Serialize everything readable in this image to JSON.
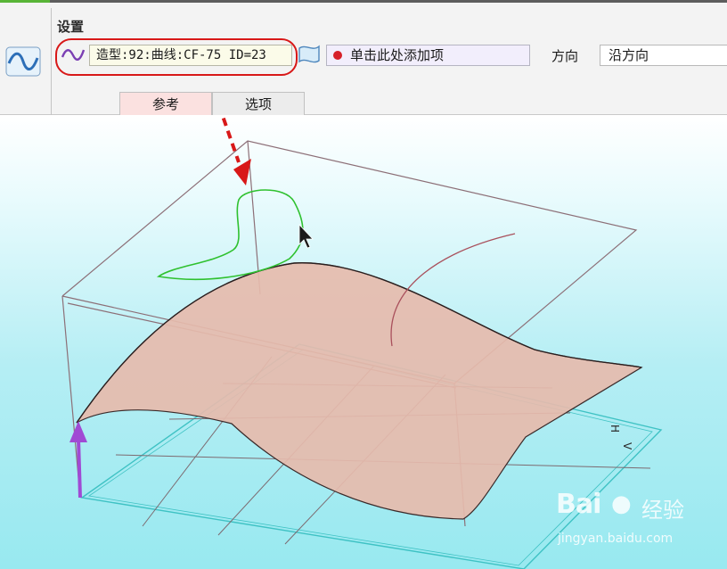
{
  "ribbon": {
    "section_title": "设置",
    "reference_field_value": "造型:92:曲线:CF-75 ID=23",
    "add_item_placeholder": "单击此处添加项",
    "direction_label": "方向",
    "direction_value": "沿方向"
  },
  "tabs": [
    {
      "label": "参考",
      "active": true
    },
    {
      "label": "选项",
      "active": false
    }
  ],
  "viewport": {
    "axis_glyphs": "H",
    "axis_glyphs_2": "V"
  },
  "watermark": {
    "logo": "Bai",
    "logo_cn": "经验",
    "url": "jingyan.baidu.com"
  },
  "colors": {
    "highlight_ring": "#d81818",
    "annotation_arrow": "#d81818",
    "surface_fill": "#e3b9ab",
    "selected_curve": "#2fc12f",
    "plane_edge": "#3fc2c4",
    "direction_arrow": "#a04ad4",
    "active_tab": "#fbe1e0"
  },
  "icons": {
    "main": "surface-sweep-icon",
    "curve": "curve-icon",
    "surface": "surface-icon",
    "add_dot": "red-dot-icon",
    "cursor": "mouse-cursor-icon"
  }
}
